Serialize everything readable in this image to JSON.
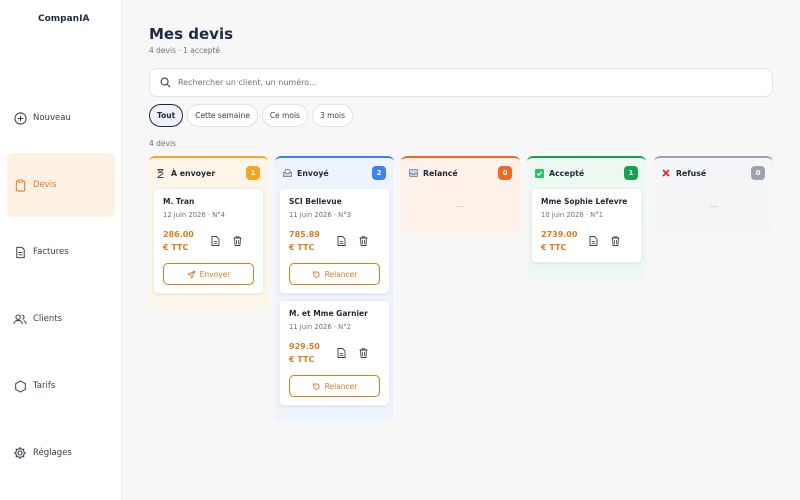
{
  "app": {
    "brand": "CompanIA"
  },
  "sidebar": {
    "items": [
      {
        "label": "Nouveau",
        "icon": "plus-circle-icon"
      },
      {
        "label": "Devis",
        "icon": "clipboard-icon"
      },
      {
        "label": "Factures",
        "icon": "document-icon"
      },
      {
        "label": "Clients",
        "icon": "users-icon"
      },
      {
        "label": "Tarifs",
        "icon": "hexagon-icon"
      },
      {
        "label": "Réglages",
        "icon": "gear-icon"
      }
    ]
  },
  "header": {
    "title": "Mes devis",
    "subtitle": "4 devis · 1 accepté"
  },
  "search": {
    "placeholder": "Rechercher un client, un numéro…",
    "value": ""
  },
  "filters": [
    "Tout",
    "Cette semaine",
    "Ce mois",
    "3 mois"
  ],
  "results_count": "4 devis",
  "columns": [
    {
      "title": "À envoyer",
      "count": "1",
      "icon": "hourglass-icon",
      "color": "#f5a524",
      "cards": [
        {
          "client": "M. Tran",
          "meta": "12 juin 2026 · N°4",
          "amount": "286.00",
          "currency": "€ TTC",
          "action": "Envoyer"
        }
      ]
    },
    {
      "title": "Envoyé",
      "count": "2",
      "icon": "outbox-icon",
      "color": "#3b82f6",
      "cards": [
        {
          "client": "SCI Bellevue",
          "meta": "11 juin 2026 · N°3",
          "amount": "785.89",
          "currency": "€ TTC",
          "action": "Relancer"
        },
        {
          "client": "M. et Mme Garnier",
          "meta": "11 juin 2026 · N°2",
          "amount": "929.50",
          "currency": "€ TTC",
          "action": "Relancer"
        }
      ]
    },
    {
      "title": "Relancé",
      "count": "0",
      "icon": "inbox-icon",
      "color": "#ef6a1f",
      "empty": "…",
      "cards": []
    },
    {
      "title": "Accepté",
      "count": "1",
      "icon": "check-box-icon",
      "color": "#16a34a",
      "cards": [
        {
          "client": "Mme Sophie Lefevre",
          "meta": "10 juin 2026 · N°1",
          "amount": "2739.00",
          "currency": "€ TTC"
        }
      ]
    },
    {
      "title": "Refusé",
      "count": "0",
      "icon": "cross-icon",
      "color": "#9ca3af",
      "empty": "…",
      "cards": []
    }
  ]
}
